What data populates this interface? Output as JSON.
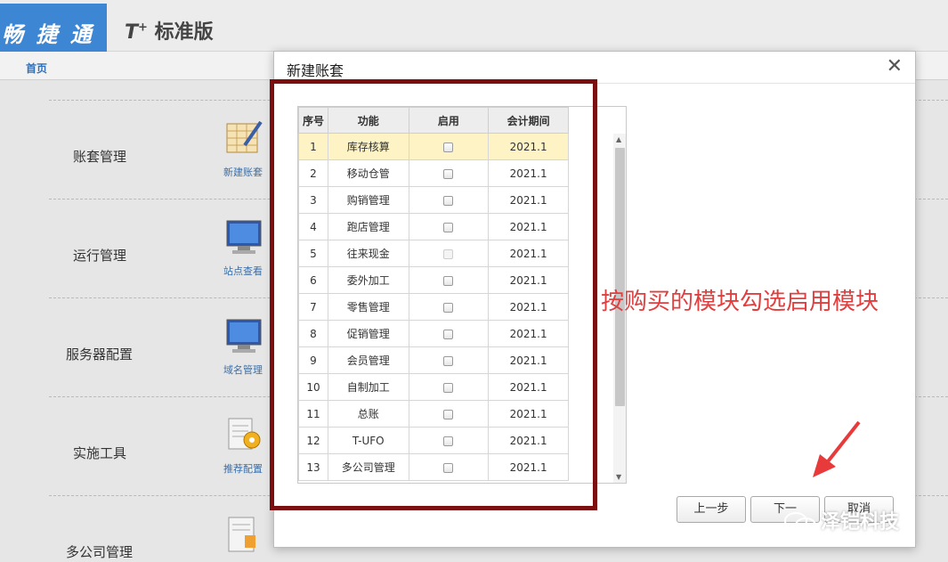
{
  "brand": {
    "logo_text": "畅 捷 通",
    "product_prefix": "T",
    "product_name": "标准版"
  },
  "nav": {
    "home_tab": "首页"
  },
  "categories": [
    {
      "label": "账套管理",
      "module": "新建账套"
    },
    {
      "label": "运行管理",
      "module": "站点查看"
    },
    {
      "label": "服务器配置",
      "module": "域名管理"
    },
    {
      "label": "实施工具",
      "module": "推荐配置"
    },
    {
      "label": "多公司管理",
      "module": ""
    }
  ],
  "dialog": {
    "title": "新建账套",
    "close_symbol": "✕",
    "columns": [
      "序号",
      "功能",
      "启用",
      "会计期间"
    ],
    "rows": [
      {
        "no": "1",
        "function": "库存核算",
        "enabled": false,
        "period": "2021.1",
        "selected": true
      },
      {
        "no": "2",
        "function": "移动仓管",
        "enabled": false,
        "period": "2021.1"
      },
      {
        "no": "3",
        "function": "购销管理",
        "enabled": false,
        "period": "2021.1"
      },
      {
        "no": "4",
        "function": "跑店管理",
        "enabled": false,
        "period": "2021.1"
      },
      {
        "no": "5",
        "function": "往来现金",
        "enabled": false,
        "period": "2021.1",
        "disabled": true
      },
      {
        "no": "6",
        "function": "委外加工",
        "enabled": false,
        "period": "2021.1"
      },
      {
        "no": "7",
        "function": "零售管理",
        "enabled": false,
        "period": "2021.1"
      },
      {
        "no": "8",
        "function": "促销管理",
        "enabled": false,
        "period": "2021.1"
      },
      {
        "no": "9",
        "function": "会员管理",
        "enabled": false,
        "period": "2021.1"
      },
      {
        "no": "10",
        "function": "自制加工",
        "enabled": false,
        "period": "2021.1"
      },
      {
        "no": "11",
        "function": "总账",
        "enabled": false,
        "period": "2021.1"
      },
      {
        "no": "12",
        "function": "T-UFO",
        "enabled": false,
        "period": "2021.1"
      },
      {
        "no": "13",
        "function": "多公司管理",
        "enabled": false,
        "period": "2021.1"
      }
    ],
    "buttons": {
      "prev": "上一步",
      "next": "下一",
      "cancel": "取消"
    }
  },
  "annotation": "按购买的模块勾选启用模块",
  "watermark": "泽铠科技",
  "colors": {
    "brand_blue": "#3d86d4",
    "highlight_border": "#7b0e0e",
    "annotation_red": "#e13f3f",
    "selected_row": "#fdf3c4"
  }
}
